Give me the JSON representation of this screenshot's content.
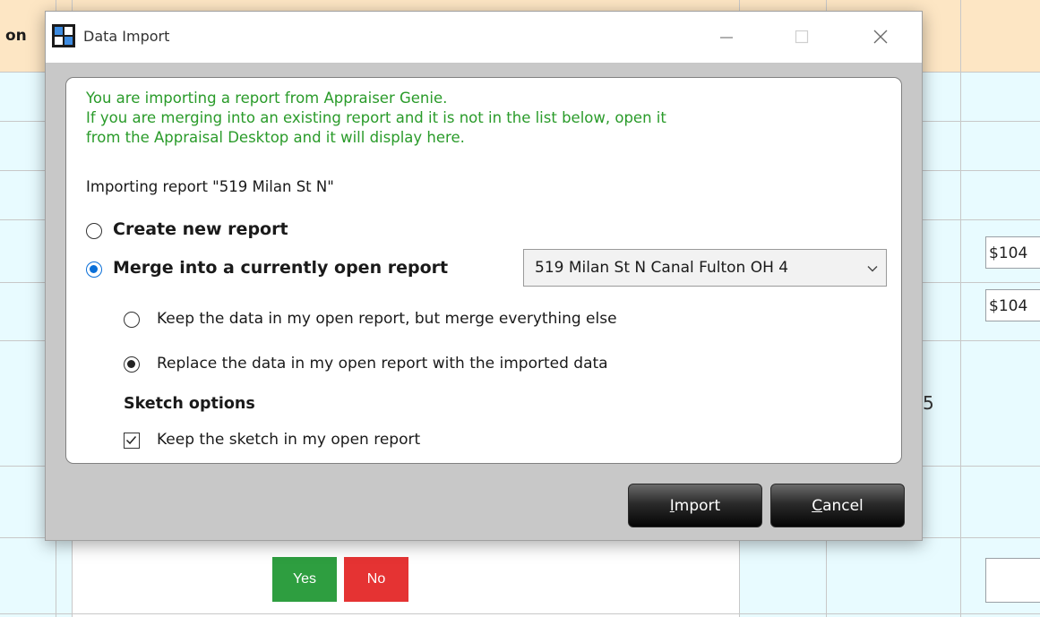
{
  "background": {
    "column_header_fragment": "on",
    "value_field_1": "$104",
    "value_field_2": "$104",
    "number_fragment": "5",
    "yes_label": "Yes",
    "no_label": "No"
  },
  "dialog": {
    "title": "Data Import",
    "info_lines": [
      "You are importing a report from Appraiser Genie.",
      "If you are merging into an existing report and it is not in the list below, open it",
      "from the Appraisal Desktop and it will display here."
    ],
    "importing_text": "Importing report \"519 Milan St N\"",
    "option_new": {
      "label": "Create new report",
      "selected": false
    },
    "option_merge": {
      "label": "Merge into a currently open report",
      "selected": true
    },
    "report_select": {
      "value": "519 Milan St N Canal Fulton OH 4"
    },
    "merge_options": [
      {
        "label": "Keep the data in my open report, but merge everything else",
        "selected": false
      },
      {
        "label": "Replace the data in my open report with the imported data",
        "selected": true
      }
    ],
    "sketch_heading": "Sketch options",
    "sketch_option": {
      "label": "Keep the sketch in my open report",
      "checked": true
    },
    "import_button": {
      "mnemonic": "I",
      "rest": "mport"
    },
    "cancel_button": {
      "mnemonic": "C",
      "rest": "ancel"
    }
  },
  "colors": {
    "info_text": "#2a9b2a",
    "radio_selected": "#0a6fd8",
    "yes_button": "#2e9e40",
    "no_button": "#e53333",
    "header_bg": "#fde6c4",
    "cell_bg": "#e8fbff"
  }
}
